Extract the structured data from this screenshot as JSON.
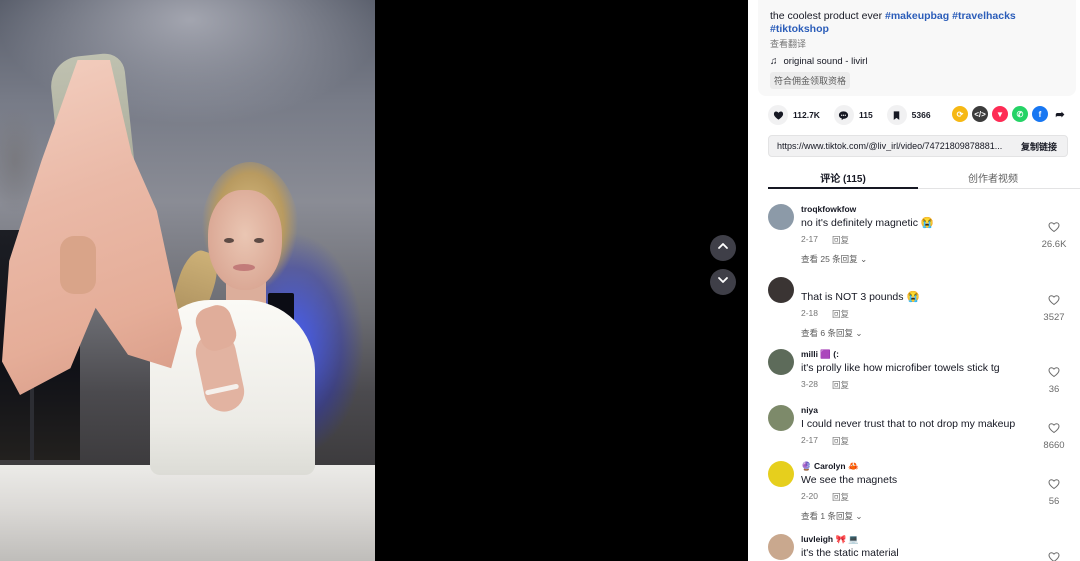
{
  "video": {
    "nav_up_icon": "chevron-up-icon",
    "nav_down_icon": "chevron-down-icon"
  },
  "description": {
    "text": "the coolest product ever",
    "hashtags": [
      "#makeupbag",
      "#travelhacks",
      "#tiktokshop"
    ],
    "translate_label": "查看翻译",
    "sound_icon": "music-note-icon",
    "sound": "original sound - livirl",
    "commission_chip": "符合佣金领取资格"
  },
  "actions": {
    "likes": "112.7K",
    "comments": "115",
    "saves": "5366"
  },
  "share_icons": [
    {
      "name": "repost-icon",
      "color": "#f6b814"
    },
    {
      "name": "embed-icon",
      "color": "#3c3c3c"
    },
    {
      "name": "send-icon",
      "color": "#fe2c55"
    },
    {
      "name": "whatsapp-icon",
      "color": "#25d366"
    },
    {
      "name": "facebook-icon",
      "color": "#1877f2"
    },
    {
      "name": "share-arrow-icon",
      "color": "#161823"
    }
  ],
  "link": {
    "url": "https://www.tiktok.com/@liv_irl/video/74721809878881...",
    "copy_label": "复制链接"
  },
  "tabs": [
    {
      "label": "评论 (115)",
      "active": true
    },
    {
      "label": "创作者视频",
      "active": false
    }
  ],
  "comments": [
    {
      "user": "troqkfowkfow",
      "text": "no it's definitely magnetic 😭",
      "date": "2-17",
      "reply": "回复",
      "more": "查看 25 条回复",
      "likes": "26.6K",
      "avatar_color": "#8c9aa8"
    },
    {
      "user": "",
      "text": "That is NOT 3 pounds 😭",
      "date": "2-18",
      "reply": "回复",
      "more": "查看 6 条回复",
      "likes": "3527",
      "avatar_color": "#3a3433"
    },
    {
      "user": "milli 🟪 (:",
      "text": "it's prolly like how microfiber towels stick tg",
      "date": "3-28",
      "reply": "回复",
      "more": "",
      "likes": "36",
      "avatar_color": "#5d6b5a"
    },
    {
      "user": "niya",
      "text": "I could never trust that to not drop my makeup",
      "date": "2-17",
      "reply": "回复",
      "more": "",
      "likes": "8660",
      "avatar_color": "#7d8a6a"
    },
    {
      "user": "🔮 Carolyn 🦀",
      "text": "We see the magnets",
      "date": "2-20",
      "reply": "回复",
      "more": "查看 1 条回复",
      "likes": "56",
      "avatar_color": "#e6cf1d"
    },
    {
      "user": "luvleigh 🎀 💻",
      "text": "it's the static material",
      "date": "",
      "reply": "",
      "more": "",
      "likes": "",
      "avatar_color": "#c9a88e"
    }
  ]
}
